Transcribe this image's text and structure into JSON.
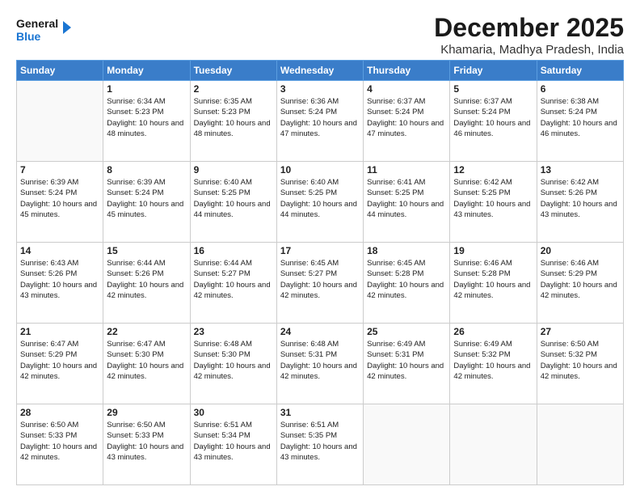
{
  "logo": {
    "line1": "General",
    "line2": "Blue"
  },
  "title": "December 2025",
  "subtitle": "Khamaria, Madhya Pradesh, India",
  "days_header": [
    "Sunday",
    "Monday",
    "Tuesday",
    "Wednesday",
    "Thursday",
    "Friday",
    "Saturday"
  ],
  "weeks": [
    [
      {
        "day": "",
        "info": ""
      },
      {
        "day": "1",
        "info": "Sunrise: 6:34 AM\nSunset: 5:23 PM\nDaylight: 10 hours\nand 48 minutes."
      },
      {
        "day": "2",
        "info": "Sunrise: 6:35 AM\nSunset: 5:23 PM\nDaylight: 10 hours\nand 48 minutes."
      },
      {
        "day": "3",
        "info": "Sunrise: 6:36 AM\nSunset: 5:24 PM\nDaylight: 10 hours\nand 47 minutes."
      },
      {
        "day": "4",
        "info": "Sunrise: 6:37 AM\nSunset: 5:24 PM\nDaylight: 10 hours\nand 47 minutes."
      },
      {
        "day": "5",
        "info": "Sunrise: 6:37 AM\nSunset: 5:24 PM\nDaylight: 10 hours\nand 46 minutes."
      },
      {
        "day": "6",
        "info": "Sunrise: 6:38 AM\nSunset: 5:24 PM\nDaylight: 10 hours\nand 46 minutes."
      }
    ],
    [
      {
        "day": "7",
        "info": "Sunrise: 6:39 AM\nSunset: 5:24 PM\nDaylight: 10 hours\nand 45 minutes."
      },
      {
        "day": "8",
        "info": "Sunrise: 6:39 AM\nSunset: 5:24 PM\nDaylight: 10 hours\nand 45 minutes."
      },
      {
        "day": "9",
        "info": "Sunrise: 6:40 AM\nSunset: 5:25 PM\nDaylight: 10 hours\nand 44 minutes."
      },
      {
        "day": "10",
        "info": "Sunrise: 6:40 AM\nSunset: 5:25 PM\nDaylight: 10 hours\nand 44 minutes."
      },
      {
        "day": "11",
        "info": "Sunrise: 6:41 AM\nSunset: 5:25 PM\nDaylight: 10 hours\nand 44 minutes."
      },
      {
        "day": "12",
        "info": "Sunrise: 6:42 AM\nSunset: 5:25 PM\nDaylight: 10 hours\nand 43 minutes."
      },
      {
        "day": "13",
        "info": "Sunrise: 6:42 AM\nSunset: 5:26 PM\nDaylight: 10 hours\nand 43 minutes."
      }
    ],
    [
      {
        "day": "14",
        "info": "Sunrise: 6:43 AM\nSunset: 5:26 PM\nDaylight: 10 hours\nand 43 minutes."
      },
      {
        "day": "15",
        "info": "Sunrise: 6:44 AM\nSunset: 5:26 PM\nDaylight: 10 hours\nand 42 minutes."
      },
      {
        "day": "16",
        "info": "Sunrise: 6:44 AM\nSunset: 5:27 PM\nDaylight: 10 hours\nand 42 minutes."
      },
      {
        "day": "17",
        "info": "Sunrise: 6:45 AM\nSunset: 5:27 PM\nDaylight: 10 hours\nand 42 minutes."
      },
      {
        "day": "18",
        "info": "Sunrise: 6:45 AM\nSunset: 5:28 PM\nDaylight: 10 hours\nand 42 minutes."
      },
      {
        "day": "19",
        "info": "Sunrise: 6:46 AM\nSunset: 5:28 PM\nDaylight: 10 hours\nand 42 minutes."
      },
      {
        "day": "20",
        "info": "Sunrise: 6:46 AM\nSunset: 5:29 PM\nDaylight: 10 hours\nand 42 minutes."
      }
    ],
    [
      {
        "day": "21",
        "info": "Sunrise: 6:47 AM\nSunset: 5:29 PM\nDaylight: 10 hours\nand 42 minutes."
      },
      {
        "day": "22",
        "info": "Sunrise: 6:47 AM\nSunset: 5:30 PM\nDaylight: 10 hours\nand 42 minutes."
      },
      {
        "day": "23",
        "info": "Sunrise: 6:48 AM\nSunset: 5:30 PM\nDaylight: 10 hours\nand 42 minutes."
      },
      {
        "day": "24",
        "info": "Sunrise: 6:48 AM\nSunset: 5:31 PM\nDaylight: 10 hours\nand 42 minutes."
      },
      {
        "day": "25",
        "info": "Sunrise: 6:49 AM\nSunset: 5:31 PM\nDaylight: 10 hours\nand 42 minutes."
      },
      {
        "day": "26",
        "info": "Sunrise: 6:49 AM\nSunset: 5:32 PM\nDaylight: 10 hours\nand 42 minutes."
      },
      {
        "day": "27",
        "info": "Sunrise: 6:50 AM\nSunset: 5:32 PM\nDaylight: 10 hours\nand 42 minutes."
      }
    ],
    [
      {
        "day": "28",
        "info": "Sunrise: 6:50 AM\nSunset: 5:33 PM\nDaylight: 10 hours\nand 42 minutes."
      },
      {
        "day": "29",
        "info": "Sunrise: 6:50 AM\nSunset: 5:33 PM\nDaylight: 10 hours\nand 43 minutes."
      },
      {
        "day": "30",
        "info": "Sunrise: 6:51 AM\nSunset: 5:34 PM\nDaylight: 10 hours\nand 43 minutes."
      },
      {
        "day": "31",
        "info": "Sunrise: 6:51 AM\nSunset: 5:35 PM\nDaylight: 10 hours\nand 43 minutes."
      },
      {
        "day": "",
        "info": ""
      },
      {
        "day": "",
        "info": ""
      },
      {
        "day": "",
        "info": ""
      }
    ]
  ]
}
